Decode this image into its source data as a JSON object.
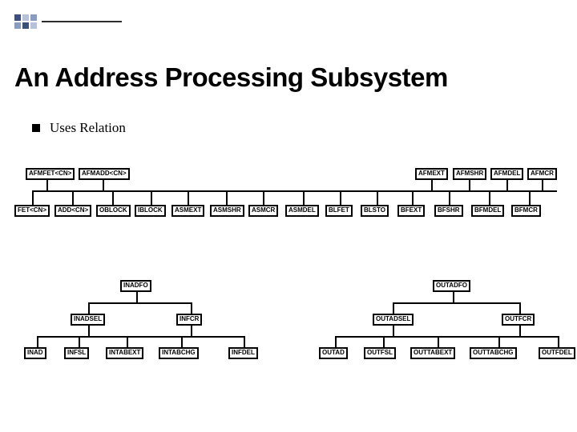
{
  "decoration": {
    "type": "corner-squares"
  },
  "title": "An Address Processing Subsystem",
  "bullet": "Uses Relation",
  "diagram": {
    "topRow": [
      "AFMFET<CN>",
      "AFMADD<CN>",
      "AFMEXT",
      "AFMSHR",
      "AFMDEL",
      "AFMCR"
    ],
    "midRow": [
      "FET<CN>",
      "ADD<CN>",
      "OBLOCK",
      "IBLOCK",
      "ASMEXT",
      "ASMSHR",
      "ASMCR",
      "ASMDEL",
      "BLFET",
      "BLSTO",
      "BFEXT",
      "BFSHR",
      "BFMDEL",
      "BFMCR"
    ],
    "leftTree": {
      "root": "INADFO",
      "mid": [
        "INADSEL",
        "INFCR"
      ],
      "leaves": [
        "INAD",
        "INFSL",
        "INTABEXT",
        "INTABCHG",
        "INFDEL"
      ]
    },
    "rightTree": {
      "root": "OUTADFO",
      "mid": [
        "OUTADSEL",
        "OUTFCR"
      ],
      "leaves": [
        "OUTAD",
        "OUTFSL",
        "OUTTABEXT",
        "OUTTABCHG",
        "OUTFDEL"
      ]
    }
  }
}
